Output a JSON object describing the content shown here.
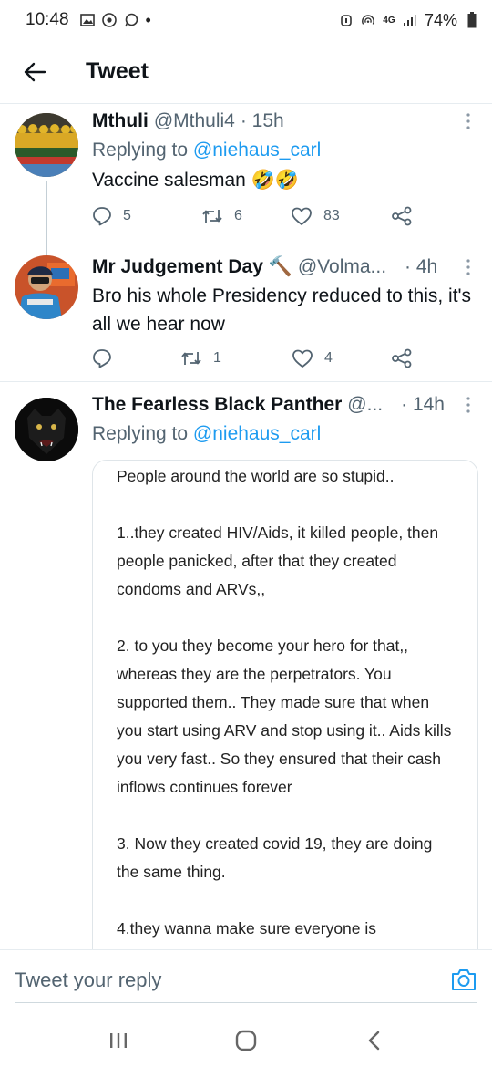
{
  "status_bar": {
    "time": "10:48",
    "dot": "•",
    "network": "4G",
    "battery": "74%",
    "icons": [
      "gallery-icon",
      "chrome-icon",
      "whatsapp-icon",
      "alarm-icon",
      "hotspot-icon",
      "signal-icon",
      "battery-icon"
    ]
  },
  "header": {
    "title": "Tweet",
    "back_icon": "arrow-left-icon"
  },
  "tweets": [
    {
      "name": "Mthuli",
      "handle": "@Mthuli4",
      "time": "· 15h",
      "reply_prefix": "Replying to",
      "reply_mention": "@niehaus_carl",
      "text": "Vaccine salesman 🤣🤣",
      "replies": "5",
      "retweets": "6",
      "likes": "83"
    },
    {
      "name": "Mr Judgement Day 🔨",
      "handle": "@Volma...",
      "time": "· 4h",
      "text": "Bro his whole Presidency reduced to this, it's all we hear now",
      "replies": "",
      "retweets": "1",
      "likes": "4"
    },
    {
      "name": "The Fearless Black Panther",
      "handle": "@...",
      "time": "· 14h",
      "reply_prefix": "Replying to",
      "reply_mention": "@niehaus_carl",
      "image_text": [
        "People around the world are so stupid..",
        "1..they created HIV/Aids, it killed people, then people panicked, after that they created condoms and ARVs,,",
        "2. to you they become your hero for that,, whereas they are the perpetrators. You supported them.. They made sure that when you start using ARV and stop using it.. Aids kills you very fast.. So they ensured that their cash inflows continues forever",
        "3. Now they created covid 19, they are doing the same thing.",
        "4.they wanna make sure everyone is"
      ]
    }
  ],
  "reply_bar": {
    "placeholder": "Tweet your reply"
  },
  "colors": {
    "accent": "#1d9bf0",
    "text": "#0f1419",
    "muted": "#536471",
    "divider": "#e6ecf0"
  }
}
